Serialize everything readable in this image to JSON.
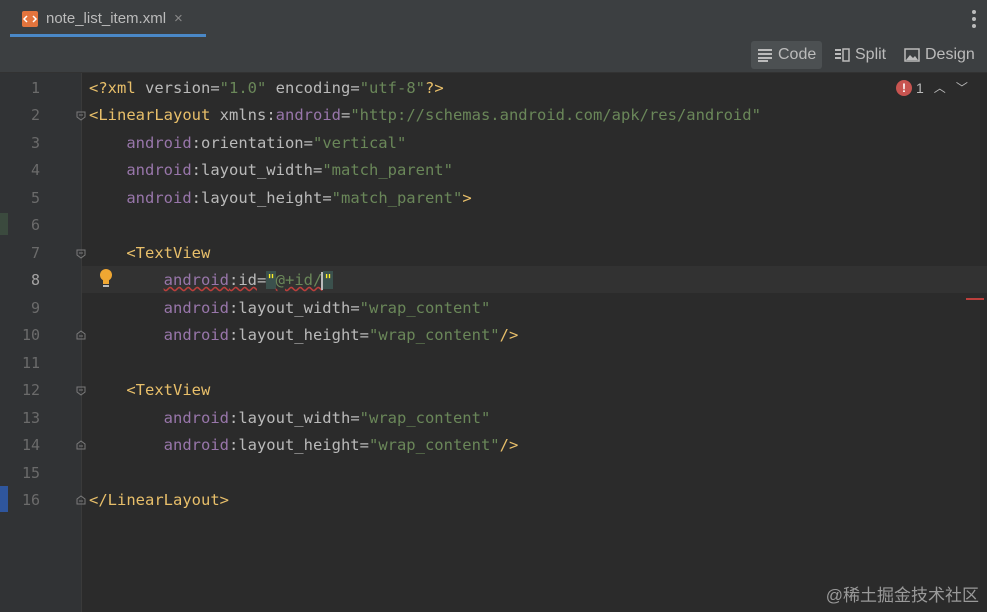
{
  "tab": {
    "title": "note_list_item.xml",
    "close": "×"
  },
  "views": {
    "code": "Code",
    "split": "Split",
    "design": "Design"
  },
  "issues": {
    "error_count": "1"
  },
  "line_numbers": [
    "1",
    "2",
    "3",
    "4",
    "5",
    "6",
    "7",
    "8",
    "9",
    "10",
    "11",
    "12",
    "13",
    "14",
    "15",
    "16"
  ],
  "code": {
    "l1": [
      "<?xml",
      " version",
      "=",
      "\"1.0\"",
      " encoding",
      "=",
      "\"utf-8\"",
      "?>"
    ],
    "l2": [
      "<LinearLayout",
      " xmlns:",
      "android",
      "=",
      "\"http://schemas.android.com/apk/res/android\""
    ],
    "l3": [
      "    ",
      "android",
      ":orientation",
      "=",
      "\"vertical\""
    ],
    "l4": [
      "    ",
      "android",
      ":layout_width",
      "=",
      "\"match_parent\""
    ],
    "l5": [
      "    ",
      "android",
      ":layout_height",
      "=",
      "\"match_parent\"",
      ">"
    ],
    "l7": [
      "    ",
      "<TextView"
    ],
    "l8": [
      "        ",
      "android",
      ":id",
      "=",
      "\"",
      "@+id/",
      "\""
    ],
    "l9": [
      "        ",
      "android",
      ":layout_width",
      "=",
      "\"wrap_content\""
    ],
    "l10": [
      "        ",
      "android",
      ":layout_height",
      "=",
      "\"wrap_content\"",
      "/>"
    ],
    "l12": [
      "    ",
      "<TextView"
    ],
    "l13": [
      "        ",
      "android",
      ":layout_width",
      "=",
      "\"wrap_content\""
    ],
    "l14": [
      "        ",
      "android",
      ":layout_height",
      "=",
      "\"wrap_content\"",
      "/>"
    ],
    "l16": [
      "</LinearLayout>"
    ]
  },
  "watermark": "@稀土掘金技术社区",
  "icons": {
    "file": "xml-file-icon",
    "bulb": "lightbulb-icon",
    "error": "error-icon"
  },
  "colors": {
    "tag": "#e8bf6a",
    "attribute": "#bababa",
    "namespace": "#9876aa",
    "value": "#6a8759",
    "accent": "#4a88c7",
    "error": "#c75450"
  }
}
